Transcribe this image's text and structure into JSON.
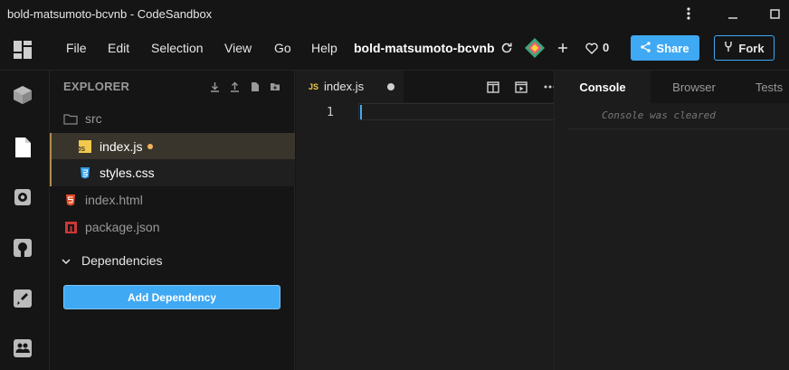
{
  "window": {
    "title": "bold-matsumoto-bcvnb - CodeSandbox"
  },
  "menu": {
    "items": [
      {
        "label": "File"
      },
      {
        "label": "Edit"
      },
      {
        "label": "Selection"
      },
      {
        "label": "View"
      },
      {
        "label": "Go"
      },
      {
        "label": "Help"
      }
    ],
    "project_name": "bold-matsumoto-bcvnb",
    "like_count": "0",
    "share_label": "Share",
    "fork_label": "Fork"
  },
  "explorer": {
    "title": "EXPLORER",
    "files": [
      {
        "name": "src",
        "icon": "folder-icon"
      },
      {
        "name": "index.js",
        "icon": "js-file-icon",
        "unsaved": true
      },
      {
        "name": "styles.css",
        "icon": "css-file-icon"
      },
      {
        "name": "index.html",
        "icon": "html-file-icon"
      },
      {
        "name": "package.json",
        "icon": "npm-file-icon"
      }
    ],
    "dependencies_label": "Dependencies",
    "add_dependency_label": "Add Dependency"
  },
  "editor": {
    "tab_label": "index.js",
    "tab_icon_label": "JS",
    "line_number": "1"
  },
  "right_panel": {
    "tabs": [
      {
        "label": "Console"
      },
      {
        "label": "Browser"
      },
      {
        "label": "Tests"
      }
    ],
    "console_message": "Console was cleared"
  },
  "colors": {
    "accent": "#40a9f3",
    "unsaved_dot": "#f2b35c",
    "active_file_bg": "#3a352c",
    "background": "#151515",
    "editor_bg": "#1c1c1c"
  }
}
